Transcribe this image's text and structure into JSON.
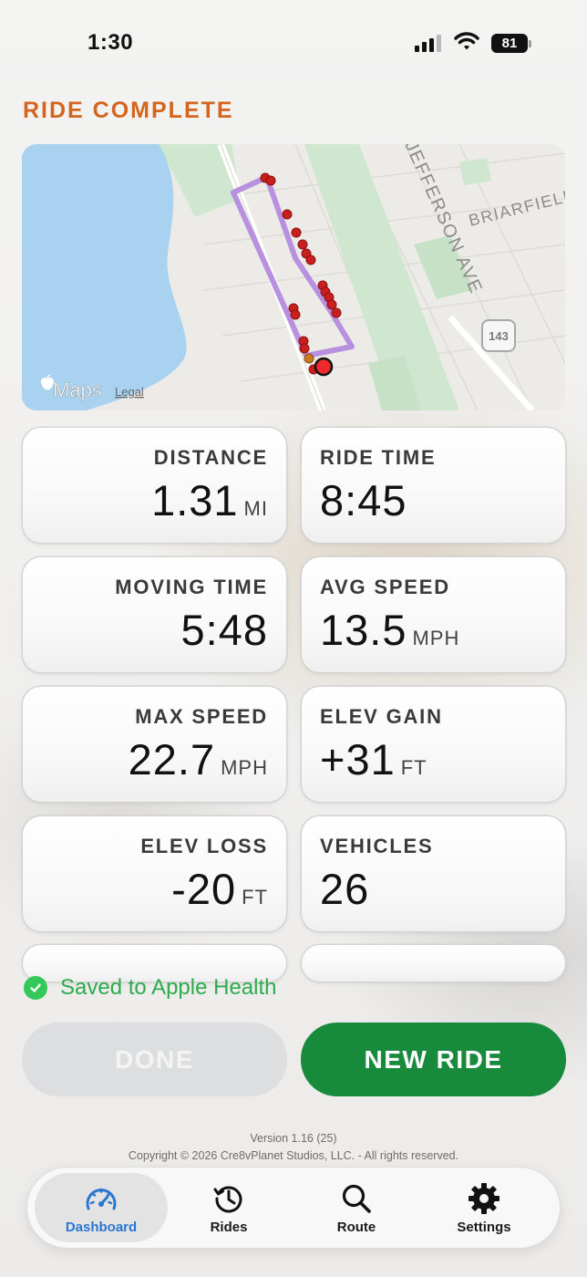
{
  "status_bar": {
    "time": "1:30",
    "battery": "81"
  },
  "header": {
    "title": "RIDE COMPLETE"
  },
  "map": {
    "attribution": "Maps",
    "legal": "Legal",
    "labels": {
      "street": "JEFFERSON AVE",
      "street2": "BRIARFIELD",
      "route_shield": "143"
    },
    "colors": {
      "water": "#a9d2f0",
      "land": "#ecebe7",
      "park": "#cfe6cf",
      "route": "#b990e0",
      "marker": "#c8201e"
    }
  },
  "stats": [
    {
      "label": "DISTANCE",
      "value": "1.31",
      "unit": "MI"
    },
    {
      "label": "RIDE TIME",
      "value": "8:45",
      "unit": ""
    },
    {
      "label": "MOVING TIME",
      "value": "5:48",
      "unit": ""
    },
    {
      "label": "AVG SPEED",
      "value": "13.5",
      "unit": "MPH"
    },
    {
      "label": "MAX SPEED",
      "value": "22.7",
      "unit": "MPH"
    },
    {
      "label": "ELEV GAIN",
      "value": "+31",
      "unit": "FT"
    },
    {
      "label": "ELEV LOSS",
      "value": "-20",
      "unit": "FT"
    },
    {
      "label": "VEHICLES",
      "value": "26",
      "unit": ""
    }
  ],
  "health": {
    "text": "Saved to Apple Health"
  },
  "actions": {
    "done_label": "DONE",
    "new_ride_label": "NEW RIDE"
  },
  "footer": {
    "version": "Version 1.16 (25)",
    "copyright": "Copyright © 2026 Cre8vPlanet Studios, LLC. - All rights reserved."
  },
  "tabs": [
    {
      "label": "Dashboard",
      "icon": "speedometer-icon",
      "active": true
    },
    {
      "label": "Rides",
      "icon": "history-icon",
      "active": false
    },
    {
      "label": "Route",
      "icon": "search-icon",
      "active": false
    },
    {
      "label": "Settings",
      "icon": "gear-icon",
      "active": false
    }
  ],
  "colors": {
    "accent_orange": "#d4641e",
    "primary_green": "#178a3c",
    "tab_active_blue": "#2a76d2",
    "health_green": "#34c759"
  }
}
